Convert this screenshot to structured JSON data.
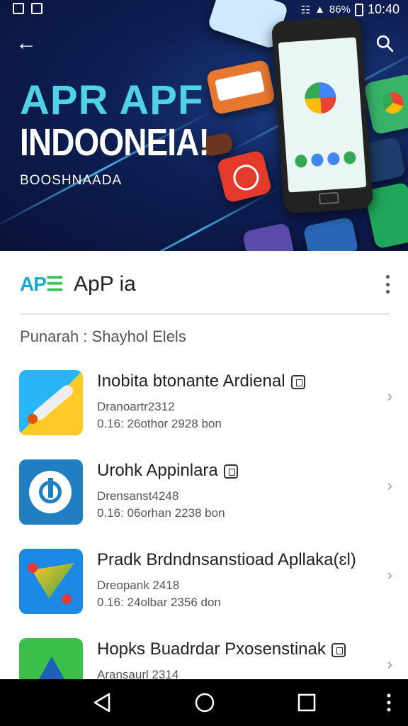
{
  "status_bar": {
    "battery": "86%",
    "time": "10:40"
  },
  "hero": {
    "headline_1": "APR APF",
    "headline_2": "INDOONEIA!",
    "subtitle": "BOOSHNAADA",
    "colors": {
      "headline_accent": "#4fd1e6",
      "background": "#0e1f54"
    }
  },
  "header": {
    "logo_text": "AP",
    "app_name": "ApP ia",
    "menu_icon": "more-vertical-icon"
  },
  "section_title": "Punarah : Shayhol Elels",
  "apps": [
    {
      "title": "Inobita btonante Ardienal",
      "meta1": "Dranoartr2312",
      "meta2": "0.16: 26othor  2928 bon"
    },
    {
      "title": "Urohk Appinlara",
      "meta1": "Drensanst4248",
      "meta2": "0.16: 06orhan  2238 bon"
    },
    {
      "title": "Pradk Brdndnsanstioad Apllaka(ɛl)",
      "meta1": "Dreopank 2418",
      "meta2": "0.16: 24olbar  2356 don"
    },
    {
      "title": "Hopks Buadrdar Pxosenstinak",
      "meta1": "Aransaurl 2314",
      "meta2": ""
    }
  ],
  "nav": {
    "back": "back-triangle-icon",
    "home": "home-circle-icon",
    "recents": "recents-square-icon",
    "more": "more-vertical-icon"
  }
}
